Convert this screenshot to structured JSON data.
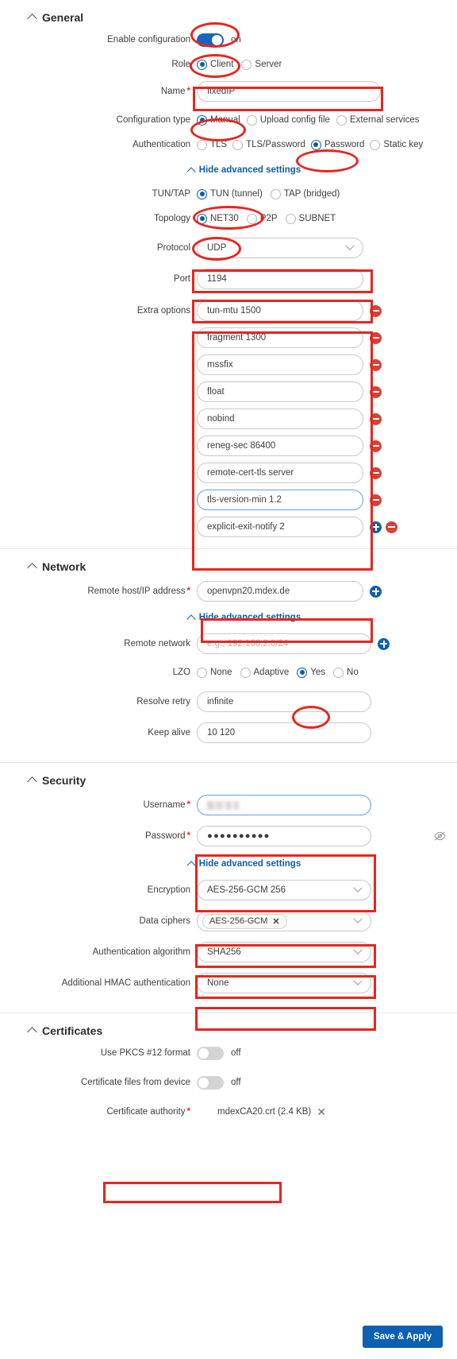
{
  "sections": {
    "general": {
      "title": "General",
      "enable_label": "Enable configuration",
      "enable_state": "on",
      "role_label": "Role",
      "role_options": [
        "Client",
        "Server"
      ],
      "role_selected": "Client",
      "name_label": "Name",
      "name_value": "fixedIP",
      "config_type_label": "Configuration type",
      "config_type_options": [
        "Manual",
        "Upload config file",
        "External services"
      ],
      "config_type_selected": "Manual",
      "auth_label": "Authentication",
      "auth_options": [
        "TLS",
        "TLS/Password",
        "Password",
        "Static key"
      ],
      "auth_selected": "Password",
      "advanced_link": "Hide advanced settings",
      "tuntap_label": "TUN/TAP",
      "tuntap_options": [
        "TUN (tunnel)",
        "TAP (bridged)"
      ],
      "tuntap_selected": "TUN (tunnel)",
      "topology_label": "Topology",
      "topology_options": [
        "NET30",
        "P2P",
        "SUBNET"
      ],
      "topology_selected": "NET30",
      "protocol_label": "Protocol",
      "protocol_value": "UDP",
      "port_label": "Port",
      "port_value": "1194",
      "extra_label": "Extra options",
      "extra_values": [
        "tun-mtu 1500",
        "fragment 1300",
        "mssfix",
        "float",
        "nobind",
        "reneg-sec 86400",
        "remote-cert-tls server",
        "tls-version-min 1.2",
        "explicit-exit-notify 2"
      ]
    },
    "network": {
      "title": "Network",
      "remote_host_label": "Remote host/IP address",
      "remote_host_value": "openvpn20.mdex.de",
      "advanced_link": "Hide advanced settings",
      "remote_network_label": "Remote network",
      "remote_network_placeholder": "e.g., 192.168.2.0/24",
      "lzo_label": "LZO",
      "lzo_options": [
        "None",
        "Adaptive",
        "Yes",
        "No"
      ],
      "lzo_selected": "Yes",
      "resolve_retry_label": "Resolve retry",
      "resolve_retry_value": "infinite",
      "keep_alive_label": "Keep alive",
      "keep_alive_value": "10 120"
    },
    "security": {
      "title": "Security",
      "username_label": "Username",
      "username_value": "",
      "password_label": "Password",
      "password_value": "●●●●●●●●●●",
      "advanced_link": "Hide advanced settings",
      "encryption_label": "Encryption",
      "encryption_value": "AES-256-GCM 256",
      "data_ciphers_label": "Data ciphers",
      "data_ciphers_chip": "AES-256-GCM",
      "auth_algo_label": "Authentication algorithm",
      "auth_algo_value": "SHA256",
      "hmac_label": "Additional HMAC authentication",
      "hmac_value": "None"
    },
    "certificates": {
      "title": "Certificates",
      "pkcs12_label": "Use PKCS #12 format",
      "pkcs12_state": "off",
      "cert_from_device_label": "Certificate files from device",
      "cert_from_device_state": "off",
      "ca_label": "Certificate authority",
      "ca_file": "mdexCA20.crt (2.4 KB)"
    }
  },
  "footer": {
    "save_label": "Save & Apply"
  },
  "colors": {
    "accent": "#0b5cab",
    "toggle_on": "#1565c0",
    "annotation": "#e8251f",
    "remove": "#d93f36",
    "add": "#0d5fb0",
    "required": "#e03030"
  }
}
